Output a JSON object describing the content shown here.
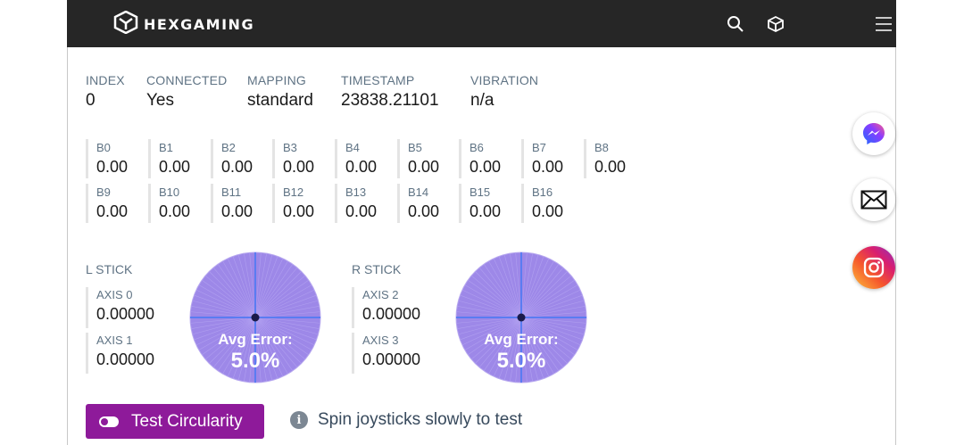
{
  "header": {
    "brand": "HEXGAMING",
    "icons": [
      "hexagon-logo-icon",
      "search-icon",
      "box-icon",
      "menu-icon"
    ]
  },
  "info": {
    "index": {
      "label": "INDEX",
      "value": "0"
    },
    "connected": {
      "label": "CONNECTED",
      "value": "Yes"
    },
    "mapping": {
      "label": "MAPPING",
      "value": "standard"
    },
    "timestamp": {
      "label": "TIMESTAMP",
      "value": "23838.21101"
    },
    "vibration": {
      "label": "VIBRATION",
      "value": "n/a"
    }
  },
  "buttons": [
    {
      "label": "B0",
      "value": "0.00"
    },
    {
      "label": "B1",
      "value": "0.00"
    },
    {
      "label": "B2",
      "value": "0.00"
    },
    {
      "label": "B3",
      "value": "0.00"
    },
    {
      "label": "B4",
      "value": "0.00"
    },
    {
      "label": "B5",
      "value": "0.00"
    },
    {
      "label": "B6",
      "value": "0.00"
    },
    {
      "label": "B7",
      "value": "0.00"
    },
    {
      "label": "B8",
      "value": "0.00"
    },
    {
      "label": "B9",
      "value": "0.00"
    },
    {
      "label": "B10",
      "value": "0.00"
    },
    {
      "label": "B11",
      "value": "0.00"
    },
    {
      "label": "B12",
      "value": "0.00"
    },
    {
      "label": "B13",
      "value": "0.00"
    },
    {
      "label": "B14",
      "value": "0.00"
    },
    {
      "label": "B15",
      "value": "0.00"
    },
    {
      "label": "B16",
      "value": "0.00"
    }
  ],
  "left_stick": {
    "title": "L STICK",
    "axes": [
      {
        "label": "AXIS 0",
        "value": "0.00000"
      },
      {
        "label": "AXIS 1",
        "value": "0.00000"
      }
    ],
    "avg_error_label": "Avg Error:",
    "avg_error_value": "5.0%"
  },
  "right_stick": {
    "title": "R STICK",
    "axes": [
      {
        "label": "AXIS 2",
        "value": "0.00000"
      },
      {
        "label": "AXIS 3",
        "value": "0.00000"
      }
    ],
    "avg_error_label": "Avg Error:",
    "avg_error_value": "5.0%"
  },
  "test_button": {
    "label": "Test Circularity"
  },
  "hint": {
    "icon": "info-icon",
    "text": "Spin joysticks slowly to test"
  },
  "social": [
    "messenger-icon",
    "mail-icon",
    "instagram-icon"
  ],
  "colors": {
    "header_bg": "#262626",
    "accent_purple": "#8e1a9a",
    "stick_fill": "#9d88e8",
    "label_gray": "#5f7384"
  }
}
